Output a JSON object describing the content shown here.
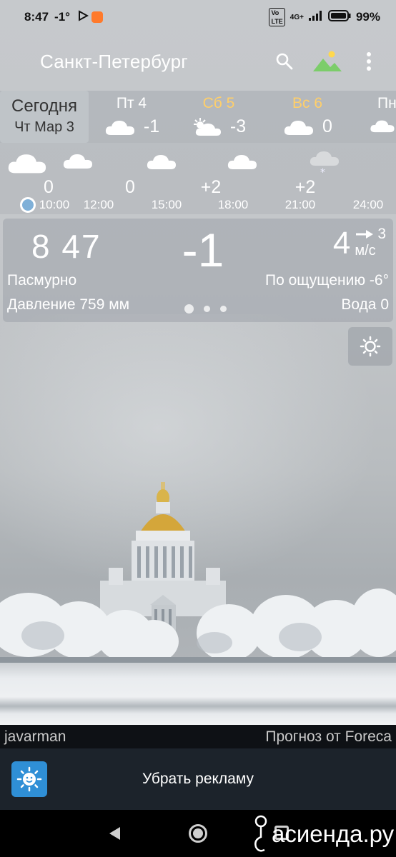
{
  "status_bar": {
    "time": "8:47",
    "temp": "-1°",
    "battery": "99%",
    "network": "4G+"
  },
  "app_bar": {
    "city": "Санкт-Петербург",
    "icons": [
      "search-icon",
      "landscape-icon",
      "more-vert-icon"
    ]
  },
  "today": {
    "label": "Сегодня",
    "date": "Чт Мар 3"
  },
  "days": [
    {
      "name": "Пт 4",
      "temp": "-1",
      "icon": "cloud-icon",
      "weekend": false
    },
    {
      "name": "Сб 5",
      "temp": "-3",
      "icon": "partly-cloudy-icon",
      "weekend": true
    },
    {
      "name": "Вс 6",
      "temp": "0",
      "icon": "cloud-icon",
      "weekend": true
    },
    {
      "name": "Пн",
      "temp": "",
      "icon": "cloud-icon",
      "weekend": false
    }
  ],
  "hourly": {
    "temps": [
      "0",
      "0",
      "+2",
      "+2"
    ],
    "times": [
      "10:00",
      "12:00",
      "15:00",
      "18:00",
      "21:00",
      "24:00"
    ],
    "icons": [
      "cloud-icon",
      "cloud-icon",
      "cloud-icon",
      "cloud-icon",
      "snow-cloud-icon"
    ]
  },
  "current": {
    "time": "8 47",
    "temp": "-1",
    "wind_speed": "4",
    "wind_gust": "3",
    "wind_unit": "м/с",
    "condition": "Пасмурно",
    "feels_like": "По ощущению -6°",
    "pressure": "Давление 759 мм",
    "water": "Вода 0"
  },
  "credits": {
    "author": "javarman",
    "source": "Прогноз от Foreca"
  },
  "ad": {
    "remove_label": "Убрать рекламу"
  },
  "watermark": {
    "text": "асиенда.ру"
  },
  "colors": {
    "weekend": "#ffcf6a",
    "now_dot": "#7fb0d8",
    "ad_bar": "#1c232b",
    "credits_bar": "#0e1115"
  }
}
